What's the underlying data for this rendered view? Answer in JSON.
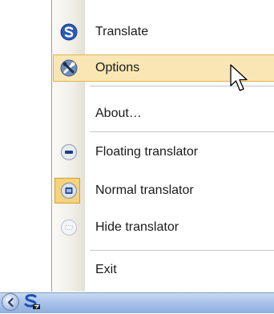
{
  "menu": {
    "items": [
      {
        "label": "Translate",
        "icon": "translate-app-icon",
        "submenu": true
      },
      {
        "label": "Options",
        "icon": "tools-icon",
        "submenu": false,
        "highlighted": true
      },
      {
        "label": "About…",
        "icon": "",
        "submenu": true
      },
      {
        "label": "Floating translator",
        "icon": "minus-circle-icon",
        "submenu": false
      },
      {
        "label": "Normal translator",
        "icon": "square-circle-icon",
        "submenu": false,
        "checked": true
      },
      {
        "label": "Hide translator",
        "icon": "dotted-circle-icon",
        "submenu": false
      },
      {
        "label": "Exit",
        "icon": "",
        "submenu": false
      }
    ]
  },
  "colors": {
    "highlight": "#f8e7b4",
    "highlight_border": "#e3b14c",
    "taskbar": "#a9c3ea",
    "icon_blue": "#2a5bb8"
  }
}
